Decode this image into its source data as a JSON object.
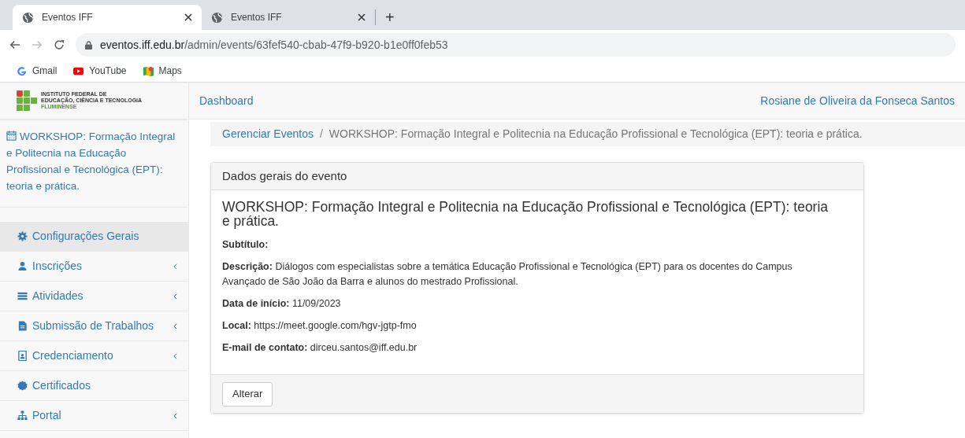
{
  "browser": {
    "tabs": [
      {
        "title": "Eventos IFF",
        "selected": true
      },
      {
        "title": "Eventos IFF",
        "selected": false
      }
    ],
    "new_tab": "+",
    "address": {
      "domain": "eventos.iff.edu.br",
      "path": "/admin/events/63fef540-cbab-47f9-b920-b1e0ff0feb53"
    },
    "bookmarks": [
      {
        "kind": "gmail",
        "label": "Gmail"
      },
      {
        "kind": "youtube",
        "label": "YouTube"
      },
      {
        "kind": "maps",
        "label": "Maps"
      }
    ]
  },
  "logo": {
    "lines": [
      "INSTITUTO FEDERAL DE",
      "EDUCAÇÃO, CIÊNCIA E TECNOLOGIA",
      "FLUMINENSE"
    ]
  },
  "navbar": {
    "link": "Dashboard",
    "user": "Rosiane de Oliveira da Fonseca Santos"
  },
  "sidebar": {
    "event_title": "WORKSHOP: Formação Integral e Politecnia na Educação Profissional e Tecnológica (EPT): teoria e prática.",
    "items": [
      {
        "kind": "gear",
        "label": "Configurações Gerais",
        "selected": true,
        "submenu": false
      },
      {
        "kind": "user",
        "label": "Inscrições",
        "selected": false,
        "submenu": true
      },
      {
        "kind": "list",
        "label": "Atividades",
        "selected": false,
        "submenu": true
      },
      {
        "kind": "file",
        "label": "Submissão de Trabalhos",
        "selected": false,
        "submenu": true
      },
      {
        "kind": "badge",
        "label": "Credenciamento",
        "selected": false,
        "submenu": true
      },
      {
        "kind": "certificate",
        "label": "Certificados",
        "selected": false,
        "submenu": false
      },
      {
        "kind": "sitemap",
        "label": "Portal",
        "selected": false,
        "submenu": true
      }
    ]
  },
  "breadcrumb_separator": "/",
  "breadcrumb": [
    "Gerenciar Eventos",
    "WORKSHOP: Formação Integral e Politecnia na Educação Profissional e Tecnológica (EPT): teoria e prática."
  ],
  "panel": {
    "heading": "Dados gerais do evento",
    "title": "WORKSHOP: Formação Integral e Politecnia na Educação Profissional e Tecnológica (EPT): teoria e prática.",
    "fields": [
      {
        "label": "Subtítulo:"
      },
      {
        "label": "Descrição:",
        "value": "Diálogos com especialistas sobre a temática Educação Profissional e Tecnológica (EPT) para os docentes do Campus Avançado de São João da Barra e alunos do mestrado Profissional."
      },
      {
        "label": "Data de início:",
        "value": "11/09/2023"
      },
      {
        "label": "Local:",
        "value": "https://meet.google.com/hgv-jgtp-fmo"
      },
      {
        "label": "E-mail de contato:",
        "value": "dirceu.santos@iff.edu.br"
      }
    ],
    "button": "Alterar"
  }
}
